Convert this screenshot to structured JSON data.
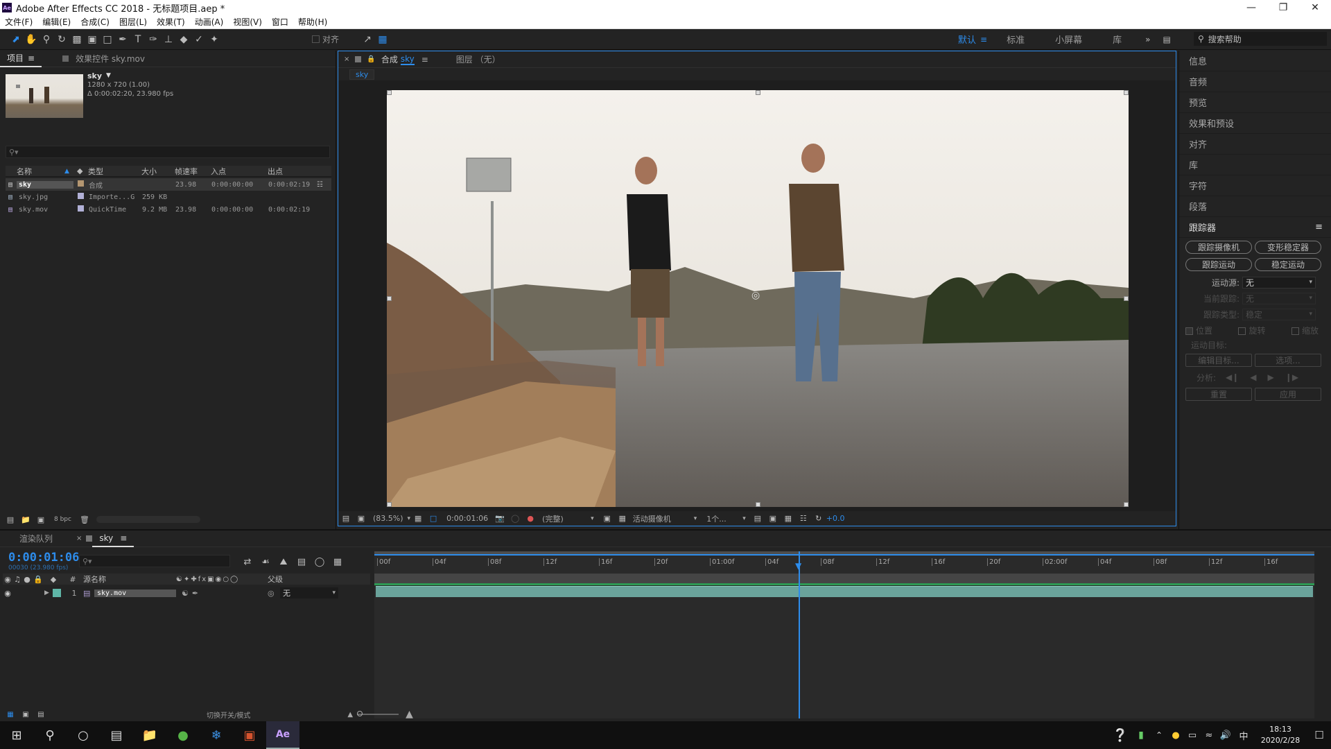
{
  "app": {
    "title": "Adobe After Effects CC 2018 - 无标题项目.aep *",
    "logo": "Ae",
    "window_controls": [
      "minimize-icon",
      "restore-icon",
      "close-icon"
    ]
  },
  "menu": [
    "文件(F)",
    "编辑(E)",
    "合成(C)",
    "图层(L)",
    "效果(T)",
    "动画(A)",
    "视图(V)",
    "窗口",
    "帮助(H)"
  ],
  "toolbar": {
    "align_label": "对齐",
    "workspaces": [
      {
        "label": "默认",
        "active": true
      },
      {
        "label": "标准",
        "active": false
      },
      {
        "label": "小屏幕",
        "active": false
      },
      {
        "label": "库",
        "active": false
      }
    ],
    "help_placeholder": "搜索帮助"
  },
  "project": {
    "tabs": [
      "项目",
      "效果控件 sky.mov"
    ],
    "preview": {
      "name": "sky",
      "size": "1280 x 720 (1.00)",
      "duration": "Δ 0:00:02:20, 23.980 fps"
    },
    "search_placeholder": "",
    "columns": [
      "名称",
      "类型",
      "大小",
      "帧速率",
      "入点",
      "出点"
    ],
    "items": [
      {
        "name": "sky",
        "type": "合成",
        "size": "",
        "fps": "23.98",
        "in": "0:00:00:00",
        "out": "0:00:02:19",
        "color": "#b49671",
        "selected": true
      },
      {
        "name": "sky.jpg",
        "type": "Importe...G",
        "size": "259 KB",
        "fps": "",
        "in": "",
        "out": "",
        "color": "#b1b0d6",
        "selected": false
      },
      {
        "name": "sky.mov",
        "type": "QuickTime",
        "size": "9.2 MB",
        "fps": "23.98",
        "in": "0:00:00:00",
        "out": "0:00:02:19",
        "color": "#b1b0d6",
        "selected": false
      }
    ],
    "bpc": "8 bpc"
  },
  "composition": {
    "tab_label": "合成",
    "tab_name": "sky",
    "layer_tab": "图层 （无）",
    "breadcrumb": "sky",
    "viewer": {
      "zoom": "(83.5%)",
      "timecode": "0:00:01:06",
      "resolution": "(完整)",
      "camera": "活动摄像机",
      "views": "1个...",
      "exposure": "+0.0"
    }
  },
  "right_panel": {
    "items": [
      "信息",
      "音频",
      "预览",
      "效果和预设",
      "对齐",
      "库",
      "字符",
      "段落"
    ],
    "tracker": {
      "title": "跟踪器",
      "buttons": [
        "跟踪摄像机",
        "变形稳定器",
        "跟踪运动",
        "稳定运动"
      ],
      "motion_source_label": "运动源:",
      "motion_source_value": "无",
      "current_track_label": "当前跟踪:",
      "current_track_value": "无",
      "track_type_label": "跟踪类型:",
      "track_type_value": "稳定",
      "checks": [
        "位置",
        "旋转",
        "缩放"
      ],
      "motion_target": "运动目标:",
      "edit_target": "编辑目标...",
      "options": "选项...",
      "analyze": "分析:",
      "reset": "重置",
      "apply": "应用"
    }
  },
  "timeline": {
    "tabs": [
      "渲染队列",
      "sky"
    ],
    "timecode": "0:00:01:06",
    "frame_info": "00030 (23.980 fps)",
    "columns": {
      "hash": "#",
      "source": "源名称",
      "parent": "父级"
    },
    "layers": [
      {
        "index": "1",
        "name": "sky.mov",
        "parent": "无",
        "color": "#5fb6a7"
      }
    ],
    "ruler": [
      "00f",
      "04f",
      "08f",
      "12f",
      "16f",
      "20f",
      "01:00f",
      "04f",
      "08f",
      "12f",
      "16f",
      "20f",
      "02:00f",
      "04f",
      "08f",
      "12f",
      "16f"
    ],
    "playhead_fraction": 0.451,
    "switch_label": "切换开关/模式"
  },
  "taskbar": {
    "time": "18:13",
    "date": "2020/2/28",
    "ime": "中"
  }
}
